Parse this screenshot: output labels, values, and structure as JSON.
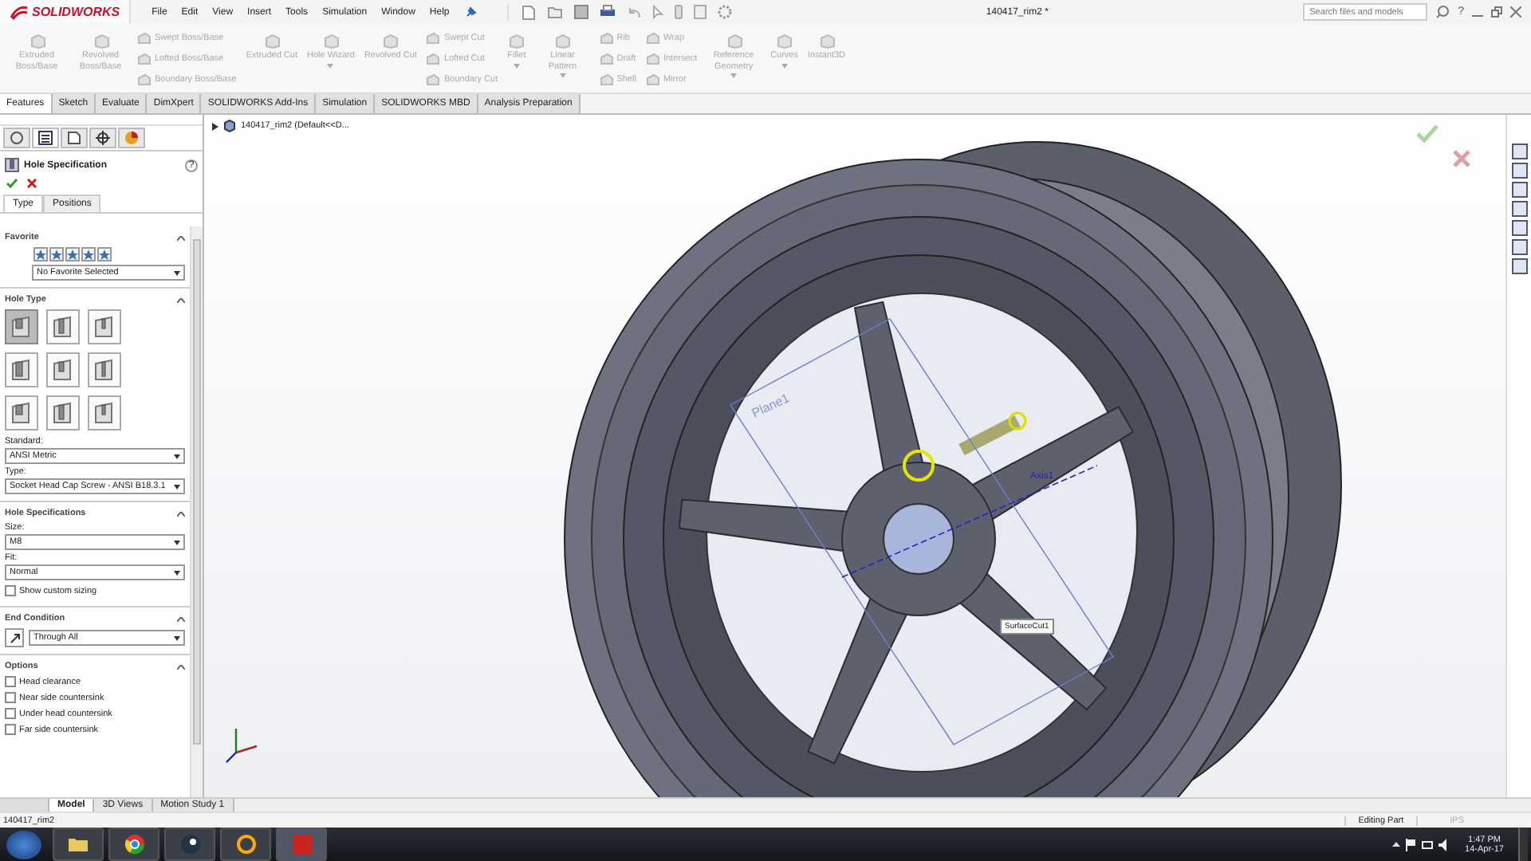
{
  "app": {
    "logo": "SOLIDWORKS",
    "menu": [
      "File",
      "Edit",
      "View",
      "Insert",
      "Tools",
      "Simulation",
      "Window",
      "Help"
    ],
    "title": "140417_rim2 *",
    "search": {
      "placeholder": "Search files and models"
    },
    "help": "?"
  },
  "ribbon": {
    "columns": [
      {
        "kind": "large",
        "items": [
          {
            "label": "Extruded Boss/Base",
            "dropdown": false
          }
        ]
      },
      {
        "kind": "large",
        "items": [
          {
            "label": "Revolved Boss/Base",
            "dropdown": false
          }
        ]
      },
      {
        "kind": "small",
        "items": [
          {
            "label": "Swept Boss/Base"
          },
          {
            "label": "Lofted Boss/Base"
          },
          {
            "label": "Boundary Boss/Base"
          }
        ]
      },
      {
        "kind": "large",
        "items": [
          {
            "label": "Extruded Cut",
            "dropdown": false
          }
        ]
      },
      {
        "kind": "large",
        "items": [
          {
            "label": "Hole Wizard",
            "dropdown": true
          }
        ]
      },
      {
        "kind": "large",
        "items": [
          {
            "label": "Revolved Cut",
            "dropdown": false
          }
        ]
      },
      {
        "kind": "small",
        "items": [
          {
            "label": "Swept Cut"
          },
          {
            "label": "Lofted Cut"
          },
          {
            "label": "Boundary Cut"
          }
        ]
      },
      {
        "kind": "large",
        "items": [
          {
            "label": "Fillet",
            "dropdown": true
          }
        ]
      },
      {
        "kind": "large",
        "items": [
          {
            "label": "Linear Pattern",
            "dropdown": true
          }
        ]
      },
      {
        "kind": "small",
        "items": [
          {
            "label": "Rib"
          },
          {
            "label": "Draft"
          },
          {
            "label": "Shell"
          }
        ]
      },
      {
        "kind": "small",
        "items": [
          {
            "label": "Wrap"
          },
          {
            "label": "Intersect"
          },
          {
            "label": "Mirror"
          }
        ]
      },
      {
        "kind": "large",
        "items": [
          {
            "label": "Reference Geometry",
            "dropdown": true
          }
        ]
      },
      {
        "kind": "large",
        "items": [
          {
            "label": "Curves",
            "dropdown": true
          }
        ]
      },
      {
        "kind": "large",
        "items": [
          {
            "label": "Instant3D",
            "dropdown": false
          }
        ]
      }
    ]
  },
  "tabs": [
    {
      "label": "Features",
      "selected": true
    },
    {
      "label": "Sketch",
      "selected": false
    },
    {
      "label": "Evaluate",
      "selected": false
    },
    {
      "label": "DimXpert",
      "selected": false
    },
    {
      "label": "SOLIDWORKS Add-Ins",
      "selected": false
    },
    {
      "label": "Simulation",
      "selected": false
    },
    {
      "label": "SOLIDWORKS MBD",
      "selected": false
    },
    {
      "label": "Analysis Preparation",
      "selected": false
    }
  ],
  "panel": {
    "title": "Hole Specification",
    "help": "?",
    "tabs": [
      {
        "label": "Type",
        "selected": true
      },
      {
        "label": "Positions",
        "selected": false
      }
    ],
    "favorite": {
      "heading": "Favorite",
      "value": "No Favorite Selected"
    },
    "hole_type": {
      "heading": "Hole Type",
      "buttons": [
        {
          "selected": true
        },
        {
          "selected": false
        },
        {
          "selected": false
        },
        {
          "selected": false
        },
        {
          "selected": false
        },
        {
          "selected": false
        },
        {
          "selected": false
        },
        {
          "selected": false
        },
        {
          "selected": false
        }
      ],
      "fields": [
        {
          "label": "Standard:",
          "value": "ANSI Metric"
        },
        {
          "label": "Type:",
          "value": "Socket Head Cap Screw - ANSI B18.3.1"
        }
      ]
    },
    "hole_specifications": {
      "heading": "Hole Specifications",
      "fields": [
        {
          "label": "Size:",
          "value": "M8"
        },
        {
          "label": "Fit:",
          "value": "Normal"
        }
      ],
      "checkbox": {
        "label": "Show custom sizing",
        "checked": false
      }
    },
    "end_condition": {
      "heading": "End Condition",
      "value": "Through All"
    },
    "options": {
      "heading": "Options",
      "checkboxes": [
        {
          "label": "Head clearance",
          "checked": false
        },
        {
          "label": "Near side countersink",
          "checked": false
        },
        {
          "label": "Under head countersink",
          "checked": false
        },
        {
          "label": "Far side countersink",
          "checked": false
        }
      ]
    }
  },
  "viewport": {
    "tree_path": "140417_rim2  (Default<<D...",
    "labels": {
      "plane": "Plane1",
      "axis": "Axis1",
      "feature": "SurfaceCut1"
    }
  },
  "bottom_tabs": [
    {
      "label": "Model",
      "selected": true
    },
    {
      "label": "3D Views",
      "selected": false
    },
    {
      "label": "Motion Study 1",
      "selected": false
    }
  ],
  "status_bar": {
    "file": "140417_rim2",
    "mode": "Editing Part",
    "units": "IPS"
  },
  "taskbar": {
    "time": "1:47 PM",
    "date": "14-Apr-17"
  }
}
